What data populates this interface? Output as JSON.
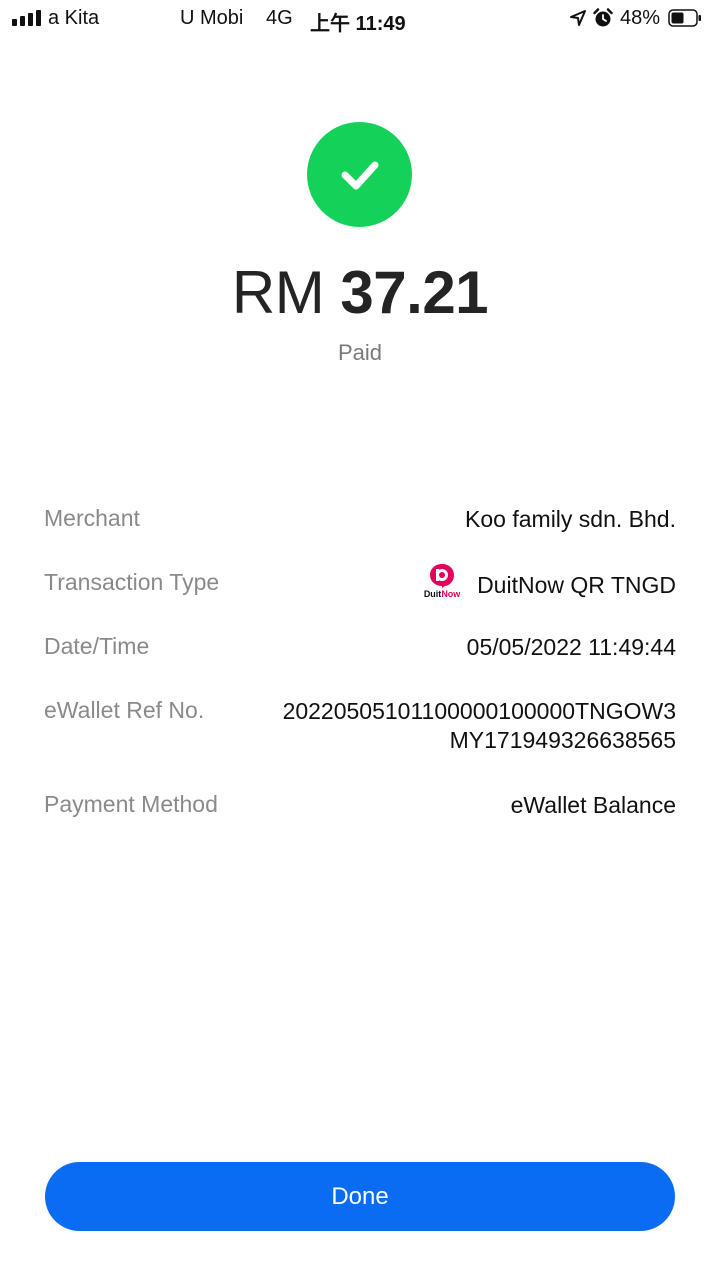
{
  "status_bar": {
    "carrier_1": "a Kita",
    "carrier_2": "U Mobi",
    "network": "4G",
    "time": "上午 11:49",
    "battery": "48%",
    "icons": [
      "signal-icon",
      "location-icon",
      "alarm-icon",
      "battery-icon"
    ]
  },
  "receipt": {
    "status_icon": "check-icon",
    "currency": "RM",
    "amount": "37.21",
    "status_label": "Paid",
    "accent_color": "#14d15a"
  },
  "details": {
    "merchant": {
      "label": "Merchant",
      "value": "Koo family sdn. Bhd."
    },
    "transaction_type": {
      "label": "Transaction Type",
      "value": "DuitNow QR TNGD",
      "logo_text_1": "Duit",
      "logo_text_2": "Now"
    },
    "datetime": {
      "label": "Date/Time",
      "value": "05/05/2022 11:49:44"
    },
    "ref": {
      "label": "eWallet Ref No.",
      "value_line_1": "20220505101100000100000TNGOW3",
      "value_line_2": "MY171949326638565"
    },
    "payment_method": {
      "label": "Payment Method",
      "value": "eWallet Balance"
    }
  },
  "actions": {
    "done_label": "Done",
    "button_color": "#0a6cf3"
  }
}
